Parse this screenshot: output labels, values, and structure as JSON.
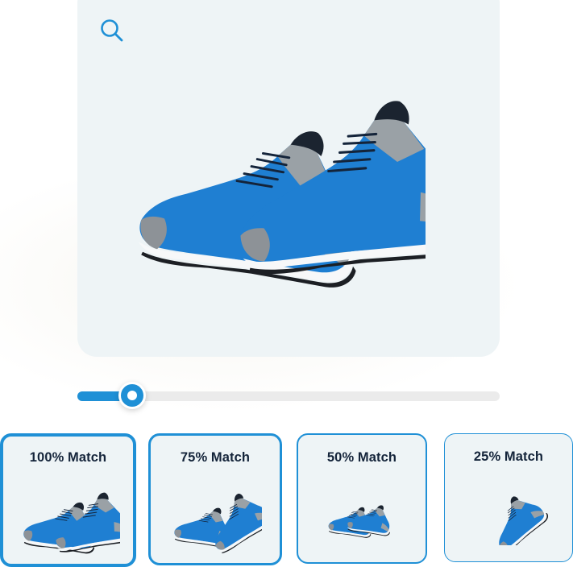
{
  "main": {
    "product_image": "blue-running-shoes-pair",
    "search_icon": "search-icon"
  },
  "similarity_slider": {
    "value_fraction": 0.13
  },
  "matches": [
    {
      "label": "100% Match",
      "selected": true
    },
    {
      "label": "75% Match",
      "selected": false
    },
    {
      "label": "50% Match",
      "selected": false
    },
    {
      "label": "25% Match",
      "selected": false
    }
  ],
  "colors": {
    "accent": "#1f90d6",
    "panel": "#eef4f6",
    "shoe": "#1f7fd2",
    "title_text": "#14243a"
  }
}
